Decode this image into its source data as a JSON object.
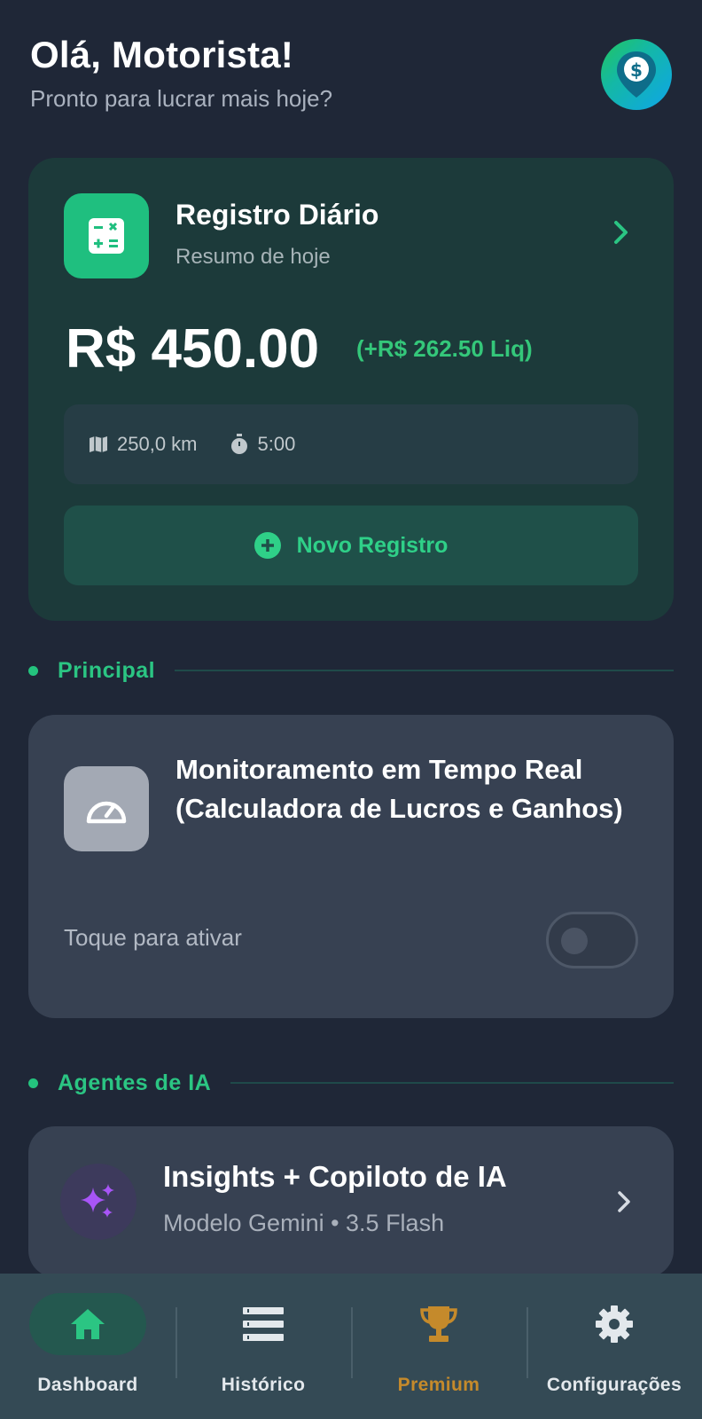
{
  "header": {
    "greeting": "Olá, Motorista!",
    "subtitle": "Pronto para lucrar mais hoje?",
    "logo_icon": "dollar-pin-icon"
  },
  "daily_card": {
    "title": "Registro Diário",
    "subtitle": "Resumo de hoje",
    "amount": "R$ 450.00",
    "net": "(+R$ 262.50 Liq)",
    "distance": "250,0 km",
    "duration": "5:00",
    "new_button_label": "Novo Registro",
    "icon": "calculator-icon"
  },
  "sections": {
    "principal": "Principal",
    "ai_agents": "Agentes de IA"
  },
  "monitor_card": {
    "title": "Monitoramento em Tempo Real (Calculadora de Lucros e Ganhos)",
    "hint": "Toque para ativar",
    "toggle_on": false,
    "icon": "speedometer-icon"
  },
  "ai_card": {
    "title": "Insights + Copiloto de IA",
    "subtitle": "Modelo Gemini • 3.5 Flash",
    "icon": "sparkles-icon"
  },
  "nav": {
    "items": [
      {
        "label": "Dashboard",
        "icon": "home-icon",
        "active": true
      },
      {
        "label": "Histórico",
        "icon": "list-icon",
        "active": false
      },
      {
        "label": "Premium",
        "icon": "trophy-icon",
        "active": false
      },
      {
        "label": "Configurações",
        "icon": "gear-icon",
        "active": false
      }
    ]
  },
  "colors": {
    "background": "#1f2737",
    "accent_green": "#2bc583",
    "premium_gold": "#c58a2b",
    "card": "#374152",
    "daily_card": "#1c3a3a"
  }
}
